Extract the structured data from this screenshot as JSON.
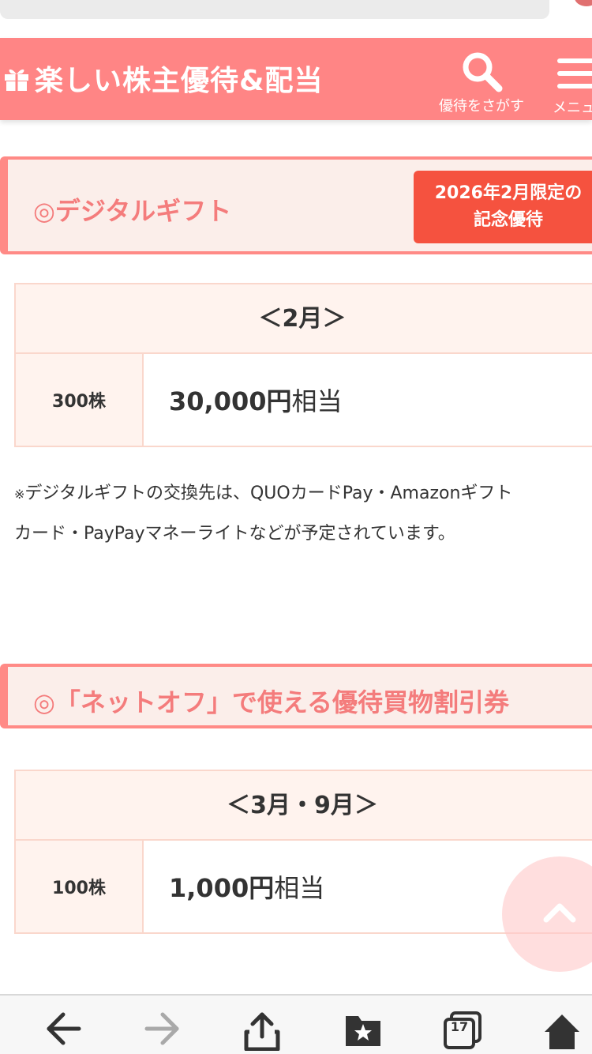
{
  "header": {
    "logo_text": "楽しい株主優待&配当",
    "search_label": "優待をさがす",
    "menu_label": "メニュー"
  },
  "section1": {
    "title": "◎デジタルギフト",
    "badge_line1": "2026年2月限定の",
    "badge_line2": "記念優待",
    "table": {
      "header": "＜2月＞",
      "rows": [
        {
          "shares": "300株",
          "amount": "30,000円",
          "unit": "相当"
        }
      ]
    },
    "note_mark": "※",
    "note_line1": "デジタルギフトの交換先は、QUOカードPay・Amazonギフト",
    "note_line2": "カード・PayPayマネーライトなどが予定されています。"
  },
  "section2": {
    "title": "◎「ネットオフ」で使える優待買物割引券",
    "table": {
      "header": "＜3月・9月＞",
      "rows": [
        {
          "shares": "100株",
          "amount": "1,000円",
          "unit": "相当"
        }
      ]
    }
  },
  "toolbar": {
    "tab_count": "17"
  },
  "colors": {
    "brand": "#ff8585",
    "title_text": "#f47c7c",
    "badge": "#f5523f",
    "table_border": "#fad7cc",
    "table_fill": "#fff3ee"
  },
  "icons": {
    "logo": "gift-icon",
    "search": "search-icon",
    "menu": "hamburger-icon",
    "scroll_top": "chevron-up-icon",
    "back": "arrow-left-icon",
    "forward": "arrow-right-icon",
    "share": "share-icon",
    "bookmarks": "bookmark-folder-icon",
    "tabs": "tabs-icon",
    "home": "home-icon"
  }
}
